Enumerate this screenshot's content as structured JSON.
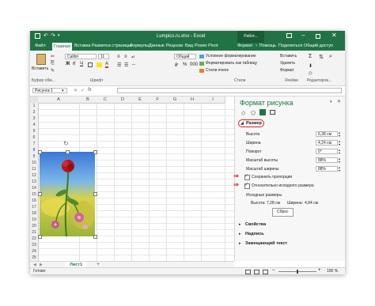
{
  "window": {
    "title": "Lumpics.ru.xlsx - Excel",
    "context_group": "Работ...",
    "user_badge": "☰"
  },
  "ribbon_tabs": [
    "Файл",
    "Главная",
    "Вставка",
    "Разметка страницы",
    "Формулы",
    "Данные",
    "Рецензи",
    "Вид",
    "Power Pivot",
    "Формат",
    "♀ Помощь",
    "Поделиться",
    "Общий доступ"
  ],
  "ribbon": {
    "paste_label": "Вставить",
    "font_name": "Calibri",
    "font_size": "11",
    "number_format": "Общий",
    "cond_format": "Условное форматирование",
    "format_table": "Форматировать как таблицу",
    "cell_styles": "Стили ячеек",
    "insert": "Вставить",
    "delete": "Удалить",
    "format": "Формат",
    "groups": {
      "clipboard": "Буфер обм...",
      "font": "Шрифт",
      "styles": "Стили",
      "cells": "Ячейки",
      "editing": "Редактиров..."
    }
  },
  "formula_bar": {
    "name_box": "Рисунок 1",
    "fx": "fx",
    "value": ""
  },
  "grid": {
    "columns": [
      "A",
      "B",
      "C",
      "D",
      "E",
      "F",
      "G",
      "H",
      "I"
    ],
    "rows": [
      "1",
      "2",
      "3",
      "4",
      "5",
      "6",
      "7",
      "8",
      "9",
      "10",
      "11",
      "12",
      "13",
      "14",
      "15",
      "16",
      "17",
      "18",
      "19",
      "20",
      "21",
      "22",
      "23",
      "24",
      "25"
    ]
  },
  "sheet": {
    "tab": "Лист1",
    "add": "+"
  },
  "status": {
    "ready": "Готово",
    "zoom": "100 %"
  },
  "pane": {
    "title": "Формат рисунка",
    "section_size": "Размер",
    "height_label": "Высота",
    "height_value": "6,38 см",
    "width_label": "Ширина",
    "width_value": "4,24 см",
    "rotation_label": "Поворот",
    "rotation_value": "0°",
    "scale_h_label": "Масштаб высоты",
    "scale_h_value": "88%",
    "scale_w_label": "Масштаб ширины",
    "scale_w_value": "88%",
    "lock_ratio": "Сохранить пропорции",
    "relative_original": "Относительно исходного размера",
    "original_size": "Исходные размеры",
    "orig_h_label": "Высота:",
    "orig_h_value": "7,28 см",
    "orig_w_label": "Ширина:",
    "orig_w_value": "4,84 см",
    "reset": "Сброс",
    "properties": "Свойства",
    "label_section": "Надпись",
    "alt_text": "Замещающий текст"
  },
  "colors": {
    "excel_green": "#217346",
    "annotation_red": "#e02020"
  }
}
